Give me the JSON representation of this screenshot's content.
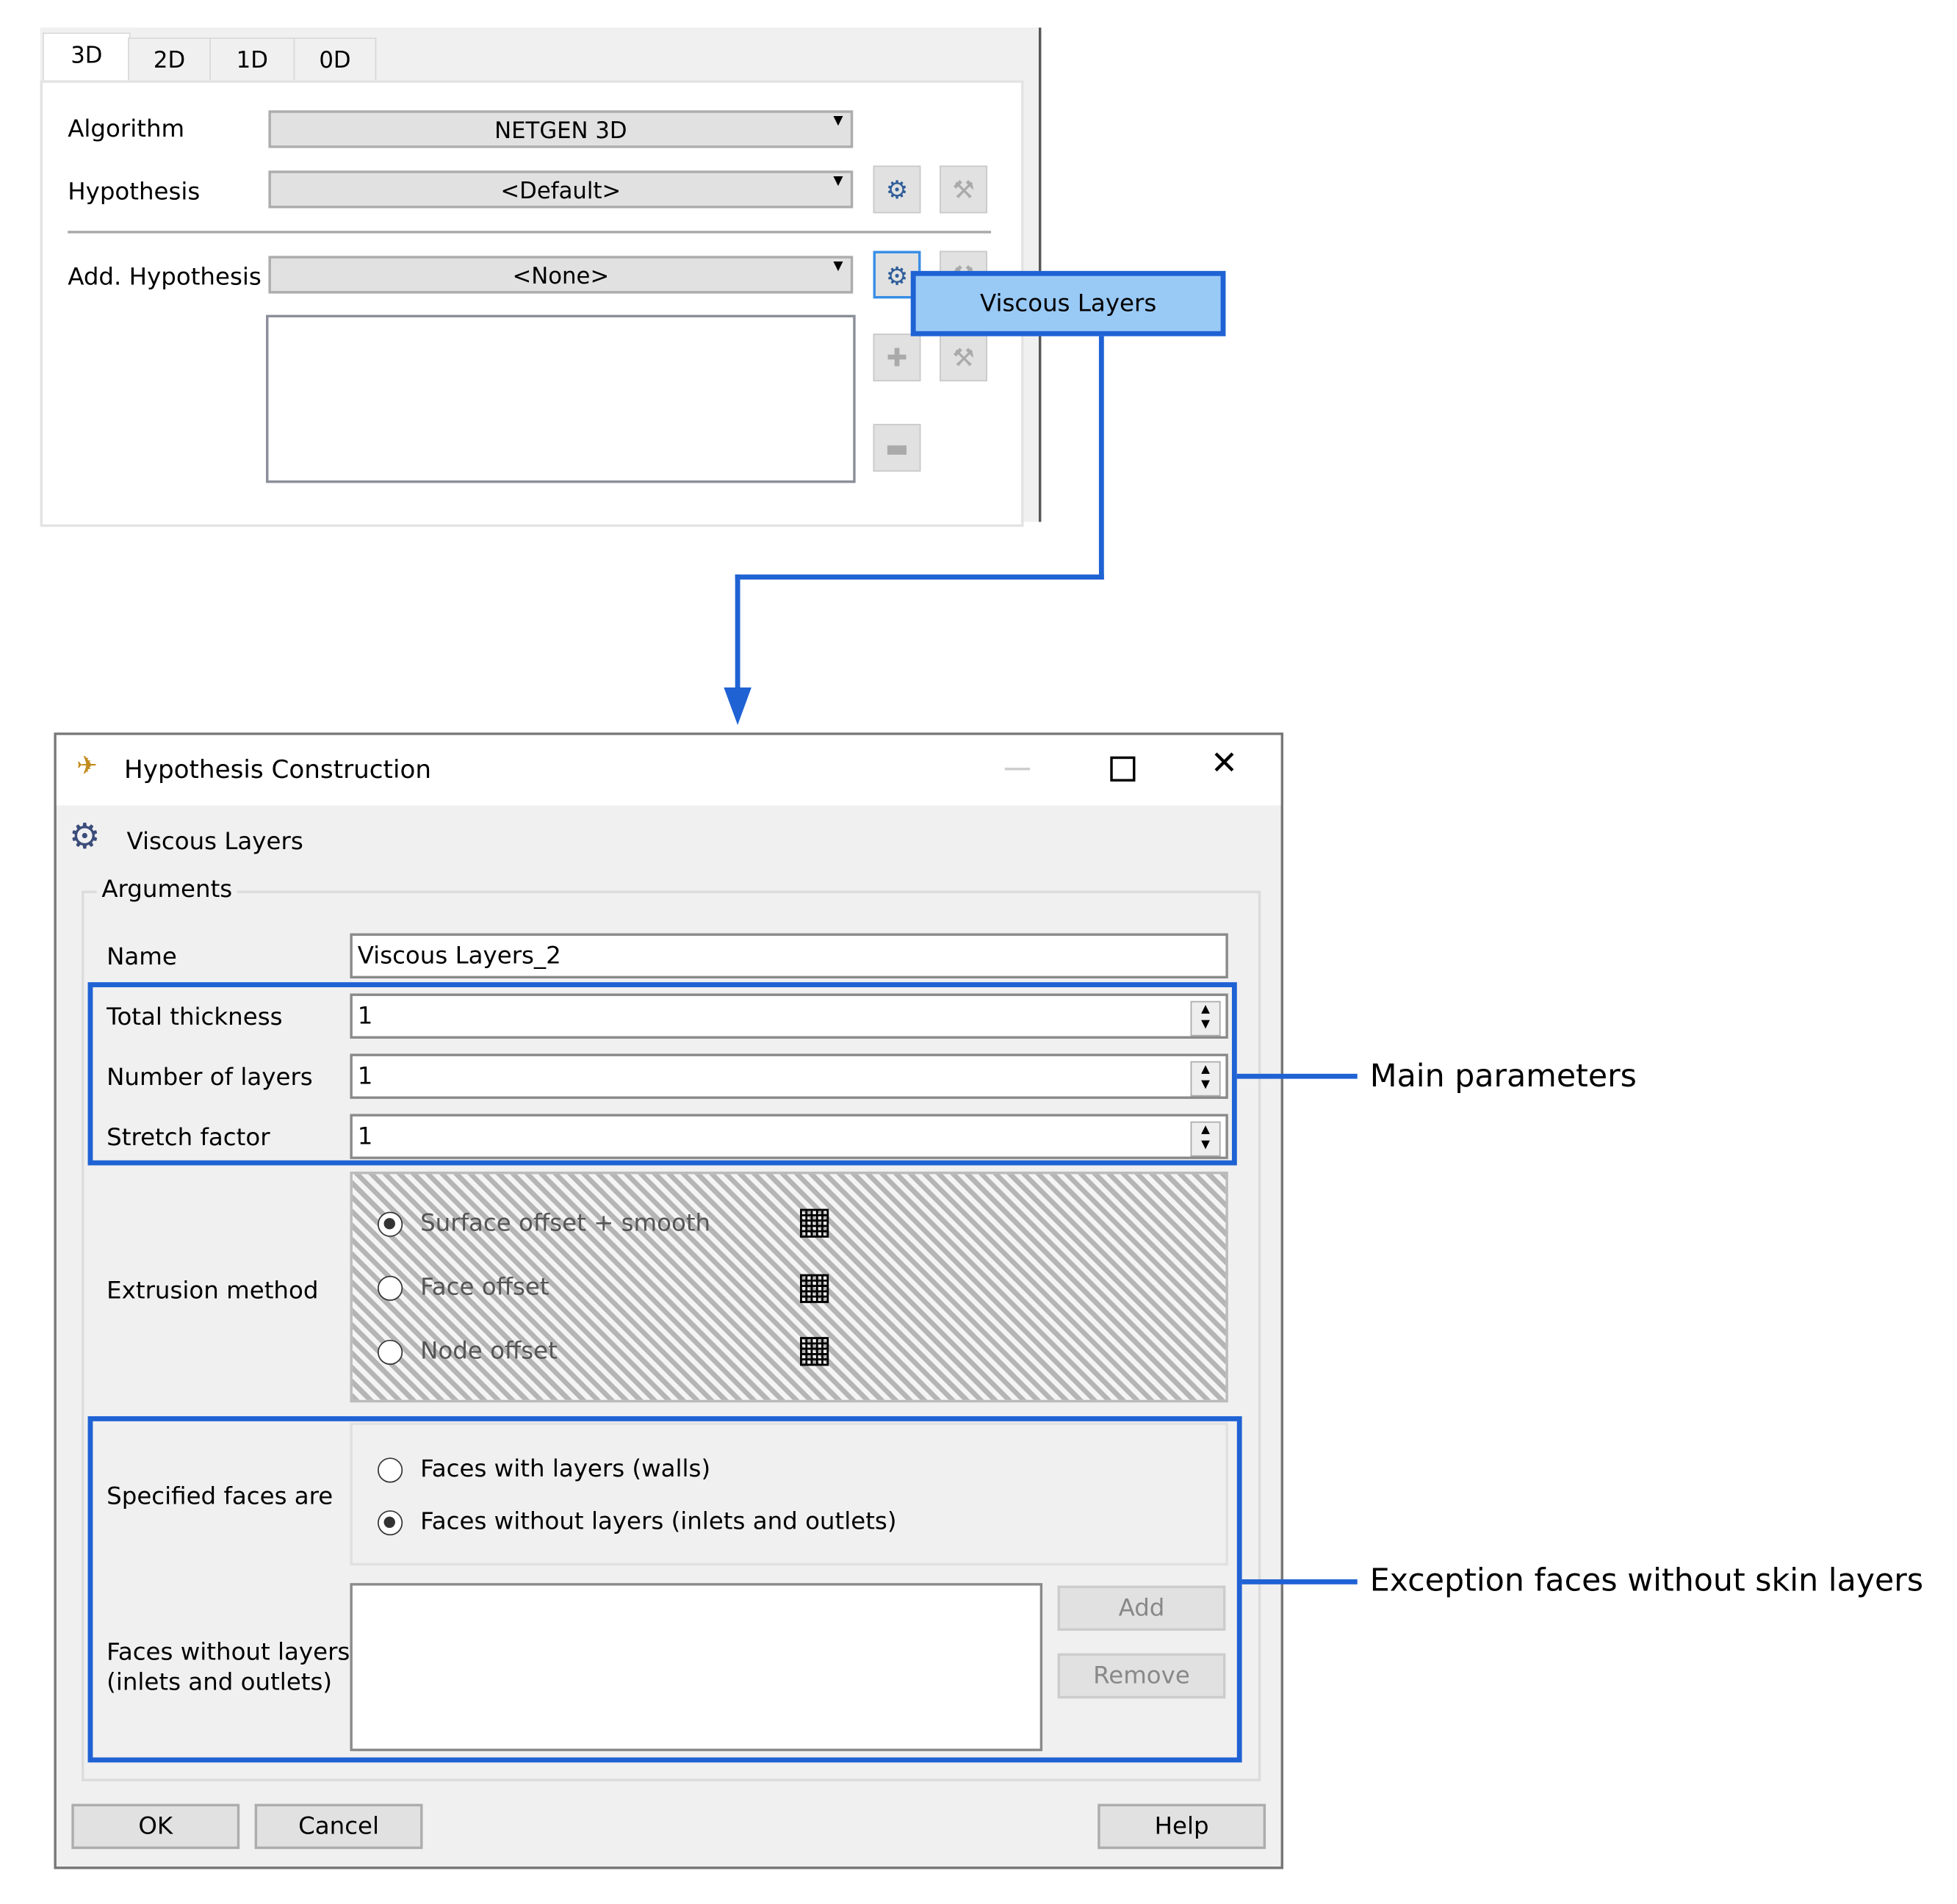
{
  "mesh_panel": {
    "tabs": [
      "3D",
      "2D",
      "1D",
      "0D"
    ],
    "active_tab": "3D",
    "algorithm_label": "Algorithm",
    "algorithm_value": "NETGEN 3D",
    "hypothesis_label": "Hypothesis",
    "hypothesis_value": "<Default>",
    "add_hypothesis_label": "Add. Hypothesis",
    "add_hypothesis_value": "<None>",
    "popup_item": "Viscous Layers"
  },
  "dialog": {
    "title": "Hypothesis Construction",
    "hypothesis_type": "Viscous Layers",
    "group_label": "Arguments",
    "name_label": "Name",
    "name_value": "Viscous Layers_2",
    "total_thickness_label": "Total thickness",
    "total_thickness_value": "1",
    "num_layers_label": "Number of layers",
    "num_layers_value": "1",
    "stretch_label": "Stretch factor",
    "stretch_value": "1",
    "extrusion_label": "Extrusion method",
    "extrusion_options": [
      "Surface offset + smooth",
      "Face offset",
      "Node offset"
    ],
    "extrusion_selected": "Surface offset + smooth",
    "specified_label": "Specified faces are",
    "specified_options": [
      "Faces with layers (walls)",
      "Faces without layers (inlets and outlets)"
    ],
    "specified_selected": "Faces without layers (inlets and outlets)",
    "faces_label_1": "Faces without layers",
    "faces_label_2": "(inlets and outlets)",
    "add_button": "Add",
    "remove_button": "Remove",
    "ok_button": "OK",
    "cancel_button": "Cancel",
    "help_button": "Help"
  },
  "annotations": {
    "main_parameters": "Main parameters",
    "exception_faces": "Exception faces without skin layers",
    "highlight_color": "#1f62d4"
  }
}
